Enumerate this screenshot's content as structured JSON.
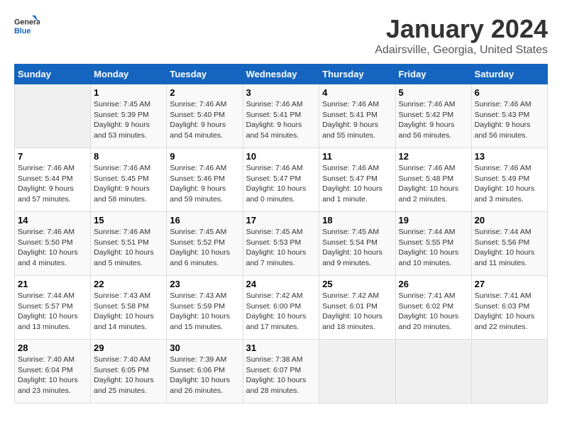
{
  "header": {
    "logo_line1": "General",
    "logo_line2": "Blue",
    "month": "January 2024",
    "location": "Adairsville, Georgia, United States"
  },
  "weekdays": [
    "Sunday",
    "Monday",
    "Tuesday",
    "Wednesday",
    "Thursday",
    "Friday",
    "Saturday"
  ],
  "weeks": [
    [
      {
        "day": "",
        "empty": true
      },
      {
        "day": "1",
        "sunrise": "Sunrise: 7:45 AM",
        "sunset": "Sunset: 5:39 PM",
        "daylight": "Daylight: 9 hours and 53 minutes."
      },
      {
        "day": "2",
        "sunrise": "Sunrise: 7:46 AM",
        "sunset": "Sunset: 5:40 PM",
        "daylight": "Daylight: 9 hours and 54 minutes."
      },
      {
        "day": "3",
        "sunrise": "Sunrise: 7:46 AM",
        "sunset": "Sunset: 5:41 PM",
        "daylight": "Daylight: 9 hours and 54 minutes."
      },
      {
        "day": "4",
        "sunrise": "Sunrise: 7:46 AM",
        "sunset": "Sunset: 5:41 PM",
        "daylight": "Daylight: 9 hours and 55 minutes."
      },
      {
        "day": "5",
        "sunrise": "Sunrise: 7:46 AM",
        "sunset": "Sunset: 5:42 PM",
        "daylight": "Daylight: 9 hours and 56 minutes."
      },
      {
        "day": "6",
        "sunrise": "Sunrise: 7:46 AM",
        "sunset": "Sunset: 5:43 PM",
        "daylight": "Daylight: 9 hours and 56 minutes."
      }
    ],
    [
      {
        "day": "7",
        "sunrise": "Sunrise: 7:46 AM",
        "sunset": "Sunset: 5:44 PM",
        "daylight": "Daylight: 9 hours and 57 minutes."
      },
      {
        "day": "8",
        "sunrise": "Sunrise: 7:46 AM",
        "sunset": "Sunset: 5:45 PM",
        "daylight": "Daylight: 9 hours and 58 minutes."
      },
      {
        "day": "9",
        "sunrise": "Sunrise: 7:46 AM",
        "sunset": "Sunset: 5:46 PM",
        "daylight": "Daylight: 9 hours and 59 minutes."
      },
      {
        "day": "10",
        "sunrise": "Sunrise: 7:46 AM",
        "sunset": "Sunset: 5:47 PM",
        "daylight": "Daylight: 10 hours and 0 minutes."
      },
      {
        "day": "11",
        "sunrise": "Sunrise: 7:46 AM",
        "sunset": "Sunset: 5:47 PM",
        "daylight": "Daylight: 10 hours and 1 minute."
      },
      {
        "day": "12",
        "sunrise": "Sunrise: 7:46 AM",
        "sunset": "Sunset: 5:48 PM",
        "daylight": "Daylight: 10 hours and 2 minutes."
      },
      {
        "day": "13",
        "sunrise": "Sunrise: 7:46 AM",
        "sunset": "Sunset: 5:49 PM",
        "daylight": "Daylight: 10 hours and 3 minutes."
      }
    ],
    [
      {
        "day": "14",
        "sunrise": "Sunrise: 7:46 AM",
        "sunset": "Sunset: 5:50 PM",
        "daylight": "Daylight: 10 hours and 4 minutes."
      },
      {
        "day": "15",
        "sunrise": "Sunrise: 7:46 AM",
        "sunset": "Sunset: 5:51 PM",
        "daylight": "Daylight: 10 hours and 5 minutes."
      },
      {
        "day": "16",
        "sunrise": "Sunrise: 7:45 AM",
        "sunset": "Sunset: 5:52 PM",
        "daylight": "Daylight: 10 hours and 6 minutes."
      },
      {
        "day": "17",
        "sunrise": "Sunrise: 7:45 AM",
        "sunset": "Sunset: 5:53 PM",
        "daylight": "Daylight: 10 hours and 7 minutes."
      },
      {
        "day": "18",
        "sunrise": "Sunrise: 7:45 AM",
        "sunset": "Sunset: 5:54 PM",
        "daylight": "Daylight: 10 hours and 9 minutes."
      },
      {
        "day": "19",
        "sunrise": "Sunrise: 7:44 AM",
        "sunset": "Sunset: 5:55 PM",
        "daylight": "Daylight: 10 hours and 10 minutes."
      },
      {
        "day": "20",
        "sunrise": "Sunrise: 7:44 AM",
        "sunset": "Sunset: 5:56 PM",
        "daylight": "Daylight: 10 hours and 11 minutes."
      }
    ],
    [
      {
        "day": "21",
        "sunrise": "Sunrise: 7:44 AM",
        "sunset": "Sunset: 5:57 PM",
        "daylight": "Daylight: 10 hours and 13 minutes."
      },
      {
        "day": "22",
        "sunrise": "Sunrise: 7:43 AM",
        "sunset": "Sunset: 5:58 PM",
        "daylight": "Daylight: 10 hours and 14 minutes."
      },
      {
        "day": "23",
        "sunrise": "Sunrise: 7:43 AM",
        "sunset": "Sunset: 5:59 PM",
        "daylight": "Daylight: 10 hours and 15 minutes."
      },
      {
        "day": "24",
        "sunrise": "Sunrise: 7:42 AM",
        "sunset": "Sunset: 6:00 PM",
        "daylight": "Daylight: 10 hours and 17 minutes."
      },
      {
        "day": "25",
        "sunrise": "Sunrise: 7:42 AM",
        "sunset": "Sunset: 6:01 PM",
        "daylight": "Daylight: 10 hours and 18 minutes."
      },
      {
        "day": "26",
        "sunrise": "Sunrise: 7:41 AM",
        "sunset": "Sunset: 6:02 PM",
        "daylight": "Daylight: 10 hours and 20 minutes."
      },
      {
        "day": "27",
        "sunrise": "Sunrise: 7:41 AM",
        "sunset": "Sunset: 6:03 PM",
        "daylight": "Daylight: 10 hours and 22 minutes."
      }
    ],
    [
      {
        "day": "28",
        "sunrise": "Sunrise: 7:40 AM",
        "sunset": "Sunset: 6:04 PM",
        "daylight": "Daylight: 10 hours and 23 minutes."
      },
      {
        "day": "29",
        "sunrise": "Sunrise: 7:40 AM",
        "sunset": "Sunset: 6:05 PM",
        "daylight": "Daylight: 10 hours and 25 minutes."
      },
      {
        "day": "30",
        "sunrise": "Sunrise: 7:39 AM",
        "sunset": "Sunset: 6:06 PM",
        "daylight": "Daylight: 10 hours and 26 minutes."
      },
      {
        "day": "31",
        "sunrise": "Sunrise: 7:38 AM",
        "sunset": "Sunset: 6:07 PM",
        "daylight": "Daylight: 10 hours and 28 minutes."
      },
      {
        "day": "",
        "empty": true
      },
      {
        "day": "",
        "empty": true
      },
      {
        "day": "",
        "empty": true
      }
    ]
  ]
}
